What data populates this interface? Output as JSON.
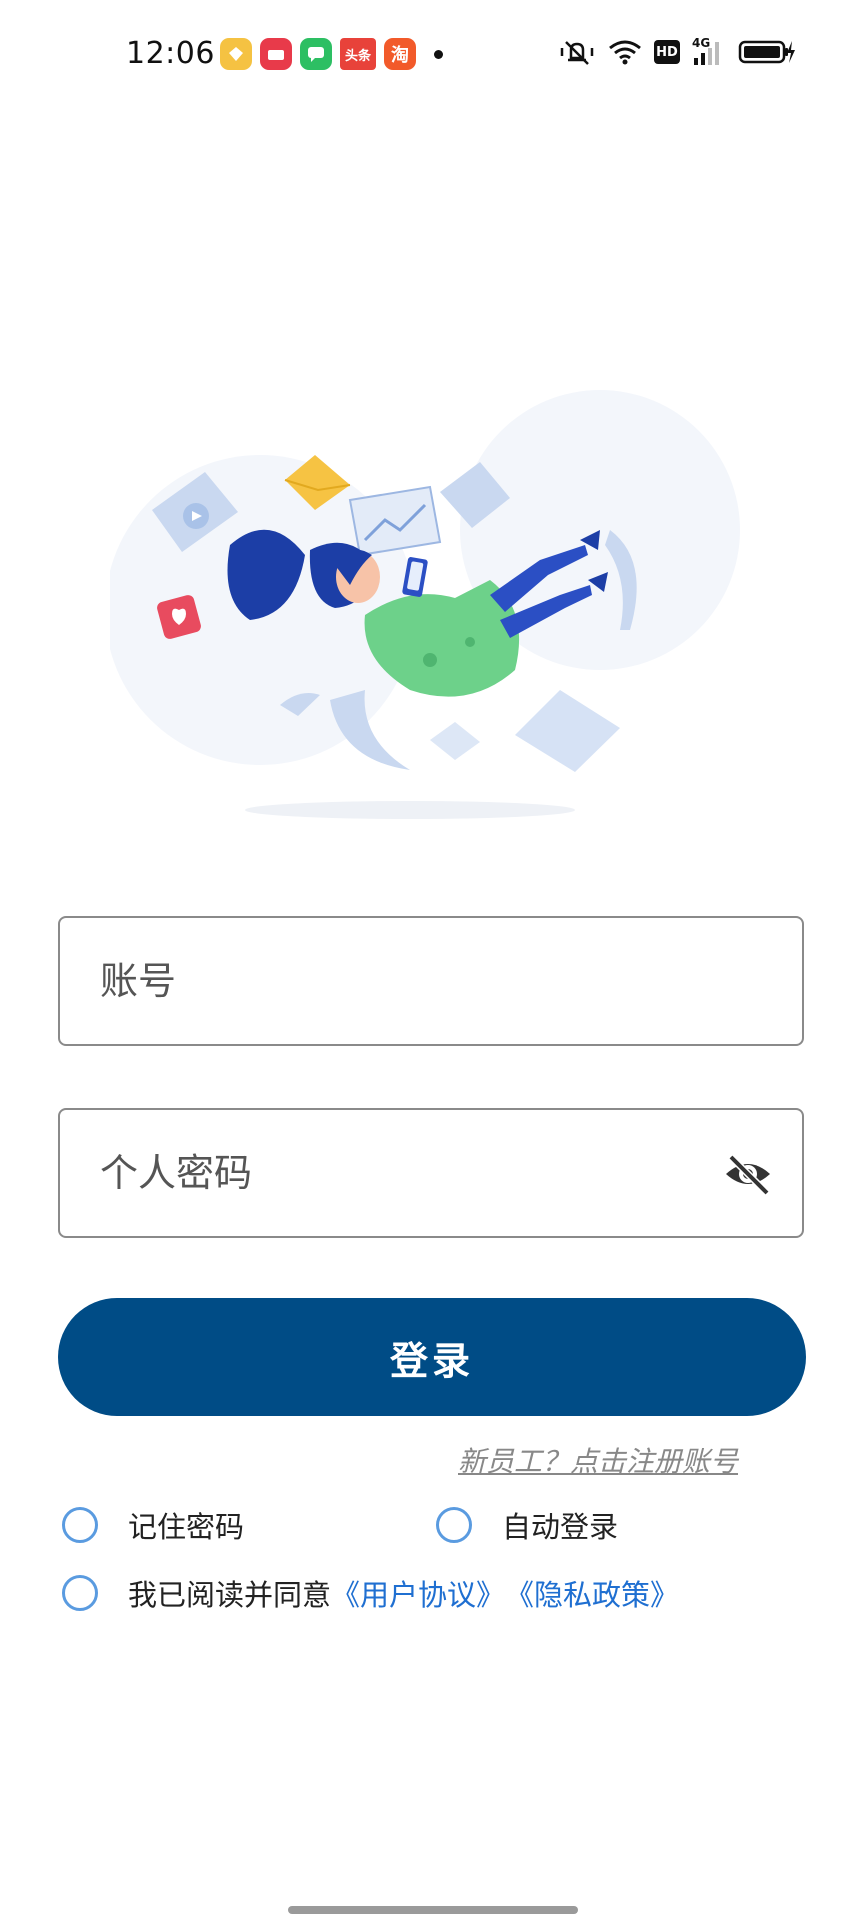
{
  "status_bar": {
    "time": "12:06",
    "notifications": [
      {
        "icon": "gold-badge-icon",
        "color": "#f5c242"
      },
      {
        "icon": "shopping-app-icon",
        "color": "#e83a4a"
      },
      {
        "icon": "chat-app-icon",
        "color": "#2dbf63"
      },
      {
        "icon": "toutiao-app-icon",
        "label": "头条",
        "color": "#e8423a"
      },
      {
        "icon": "taobao-app-icon",
        "label": "淘",
        "color": "#f25a2a"
      }
    ],
    "network_badge": "HD",
    "network_type": "4G"
  },
  "login_form": {
    "account_placeholder": "账号",
    "password_placeholder": "个人密码",
    "login_label": "登录",
    "register_link": "新员工？点击注册账号",
    "remember_password": "记住密码",
    "auto_login": "自动登录",
    "agree_prefix": "我已阅读并同意",
    "user_agreement": "《用户协议》",
    "privacy_policy": "《隐私政策》"
  },
  "colors": {
    "primary": "#004c86",
    "link": "#1f6fd1",
    "radio_border": "#5a9be0"
  }
}
